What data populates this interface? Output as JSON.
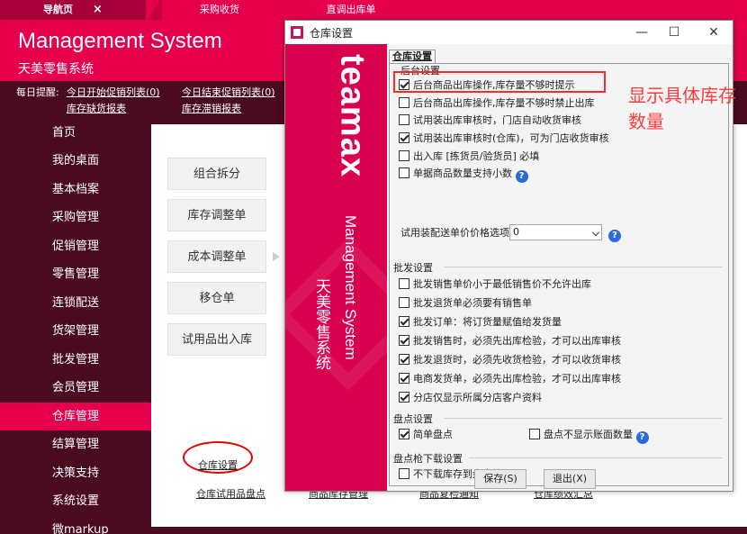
{
  "tabs": [
    {
      "label": "导航页",
      "close": "×"
    },
    {
      "label": "采购收货"
    },
    {
      "label": "直调出库单"
    }
  ],
  "header": {
    "title": "Management System",
    "subtitle": "天美零售系统"
  },
  "reminder": {
    "label": "每日提醒:",
    "links": [
      "今日开始促销列表(0)",
      "今日结束促销列表(0)",
      "库存缺货报表",
      "库存滞销报表"
    ]
  },
  "sidebar": {
    "items": [
      "首页",
      "我的桌面",
      "基本档案",
      "采购管理",
      "促销管理",
      "零售管理",
      "连锁配送",
      "货架管理",
      "批发管理",
      "会员管理",
      "仓库管理",
      "结算管理",
      "决策支持",
      "系统设置",
      "微markup"
    ]
  },
  "main": {
    "buttons": [
      "组合拆分",
      "库存调整单",
      "成本调整单",
      "移仓单",
      "试用品出入库"
    ],
    "bottom_links": [
      "仓库设置",
      "仓库试用品盘点",
      "商品库存管理",
      "商品复检通知",
      "仓库绩效汇总"
    ]
  },
  "dialog": {
    "title": "仓库设置",
    "window_buttons": {
      "minimize": "—",
      "maximize": "☐",
      "close": "✕"
    },
    "brand": {
      "logo": "teamax",
      "vertical_en": "Management System",
      "vertical_cn": "天美零售系统"
    },
    "tab": "仓库设置",
    "groups": {
      "backend": {
        "title": "后台设置",
        "options": [
          {
            "label": "后台商品出库操作,库存量不够时提示",
            "checked": true
          },
          {
            "label": "后台商品出库操作,库存量不够时禁止出库",
            "checked": false
          },
          {
            "label": "试用装出库审核时，门店自动收货审核",
            "checked": false
          },
          {
            "label": "试用装出库审核时(仓库)，可为门店收货审核",
            "checked": true
          },
          {
            "label": "出入库 [拣货员/验货员] 必填",
            "checked": false
          },
          {
            "label": "单据商品数量支持小数",
            "checked": false
          }
        ],
        "price_option_label": "试用装配送单价价格选项",
        "price_option_value": "0"
      },
      "wholesale": {
        "title": "批发设置",
        "options": [
          {
            "label": "批发销售单价小于最低销售价不允许出库",
            "checked": false
          },
          {
            "label": "批发退货单必须要有销售单",
            "checked": false
          },
          {
            "label": "批发订单：将订货量赋值给发货量",
            "checked": true
          },
          {
            "label": "批发销售时，必须先出库检验，才可以出库审核",
            "checked": true
          },
          {
            "label": "批发退货时，必须先收货检验，才可以收货审核",
            "checked": true
          },
          {
            "label": "电商发货单，必须先出库检验，才可以出库审核",
            "checked": true
          },
          {
            "label": "分店仅显示所属分店客户资料",
            "checked": true
          }
        ]
      },
      "inventory": {
        "title": "盘点设置",
        "options": [
          {
            "label": "简单盘点",
            "checked": true
          },
          {
            "label": "盘点不显示账面数量",
            "checked": false
          }
        ]
      },
      "scanner": {
        "title": "盘点枪下载设置",
        "options": [
          {
            "label": "不下载库存到盘点枪",
            "checked": false
          }
        ]
      }
    },
    "save_label": "保存(S)",
    "exit_label": "退出(X)"
  },
  "annotation": "显示具体库存数量",
  "colors": {
    "brand_pink": "#e6004c",
    "dark_maroon": "#4a0a20",
    "annotation_red": "#ff3b3b",
    "help_blue": "#2a6ad9"
  }
}
